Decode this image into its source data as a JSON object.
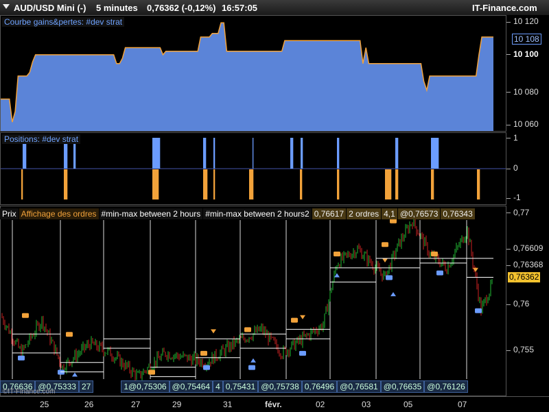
{
  "title": {
    "instrument": "AUD/USD Mini (-)",
    "timeframe": "5 minutes",
    "price": "0,76362 (-0,12%)",
    "time": "16:57:05",
    "brand": "IT-Finance.com"
  },
  "equity_panel": {
    "label": "Courbe gains&pertes: #dev strat",
    "ticks": [
      "10 120",
      "10 108",
      "10 100",
      "10 080",
      "10 060"
    ],
    "chart_data": {
      "type": "area",
      "y": [
        10075,
        10075,
        10075,
        10075,
        10062,
        10068,
        10088,
        10088,
        10088,
        10088,
        10090,
        10096,
        10100,
        10100,
        10100,
        10100,
        10100,
        10100,
        10100,
        10100,
        10100,
        10100,
        10100,
        10100,
        10100,
        10100,
        10100,
        10100,
        10100,
        10100,
        10100,
        10100,
        10100,
        10100,
        10100,
        10100,
        10100,
        10100,
        10100,
        10100,
        10095,
        10095,
        10098,
        10104,
        10104,
        10104,
        10104,
        10104,
        10104,
        10104,
        10104,
        10104,
        10104,
        10104,
        10104,
        10104,
        10100,
        10102,
        10102,
        10102,
        10102,
        10102,
        10102,
        10102,
        10102,
        10102,
        10102,
        10102,
        10102,
        10110,
        10110,
        10110,
        10110,
        10112,
        10112,
        10112,
        10118,
        10118,
        10102,
        10102,
        10102,
        10102,
        10102,
        10102,
        10102,
        10102,
        10102,
        10102,
        10102,
        10102,
        10102,
        10102,
        10102,
        10102,
        10102,
        10102,
        10102,
        10102,
        10108,
        10108,
        10108,
        10108,
        10108,
        10108,
        10108,
        10108,
        10108,
        10108,
        10108,
        10108,
        10108,
        10108,
        10108,
        10108,
        10108,
        10108,
        10108,
        10108,
        10108,
        10108,
        10108,
        10108,
        10108,
        10108,
        10108,
        10095,
        10104,
        10095,
        10095,
        10095,
        10095,
        10095,
        10095,
        10095,
        10095,
        10095,
        10095,
        10095,
        10095,
        10095,
        10095,
        10095,
        10095,
        10095,
        10095,
        10095,
        10085,
        10080,
        10088,
        10088,
        10088,
        10088,
        10088,
        10088,
        10088,
        10088,
        10088,
        10088,
        10088,
        10088,
        10088,
        10088,
        10088,
        10088,
        10088,
        10100,
        10110,
        10110,
        10110,
        10110,
        10110
      ],
      "ylim": [
        10057,
        10122
      ]
    }
  },
  "positions_panel": {
    "label": "Positions: #dev strat",
    "ticks": [
      "1",
      "0",
      "-1"
    ],
    "long_x": [
      32,
      33,
      34,
      35,
      36,
      92,
      93,
      94,
      95,
      96,
      106,
      107,
      108,
      221,
      222,
      223,
      224,
      225,
      226,
      227,
      228,
      229,
      230,
      231,
      295,
      296,
      297,
      298,
      310,
      311,
      367,
      422,
      423,
      424,
      425,
      437,
      438,
      439,
      490,
      491,
      492,
      575,
      576,
      577,
      578,
      627,
      628,
      629,
      630,
      631,
      632,
      633,
      634,
      635,
      636,
      637
    ],
    "short_x": [
      30,
      31,
      92,
      93,
      94,
      95,
      96,
      221,
      222,
      223,
      224,
      225,
      226,
      227,
      228,
      229,
      295,
      296,
      297,
      298,
      299,
      300,
      310,
      311,
      362,
      363,
      364,
      365,
      366,
      367,
      436,
      437,
      438,
      490,
      491,
      492,
      560,
      561,
      562,
      563,
      564,
      565,
      566,
      567,
      568,
      575,
      576,
      577,
      578,
      627,
      628,
      629,
      630,
      694,
      695,
      696,
      697
    ]
  },
  "price_panel": {
    "legend": [
      "Prix",
      "Affichage des ordres",
      "#min-max between 2 hours",
      "#min-max between 2 hours2",
      "0,76617",
      "2 ordres",
      "4,1",
      "@0,76573",
      "0,76343"
    ],
    "ticks": [
      "0,77",
      "0,76609",
      "0,76368",
      "0,76",
      "0,755"
    ],
    "current_price": "0,76362",
    "orders": [
      "0,76636",
      "@0,75333",
      "27",
      "1@0,75306",
      "@0,75464",
      "4",
      "0,75431",
      "@0,75738",
      "0,76496",
      "@0,76581",
      "@0,76635",
      "@0,76126"
    ],
    "chart_data": {
      "type": "line",
      "ylim": [
        0.7515,
        0.7715
      ],
      "colors": {
        "up": "#22bb33",
        "down": "#cc2222"
      }
    }
  },
  "time_axis": {
    "labels": [
      "25",
      "26",
      "27",
      "29",
      "31",
      "févr.",
      "02",
      "03",
      "05",
      "07"
    ]
  },
  "watermark": "©IT-Finance.com",
  "colors": {
    "equity_fill": "#5b84d8",
    "equity_edge": "#f2a23a",
    "long": "#6b9cff",
    "short": "#f2a23a",
    "current_price_bg": "#f2c12e"
  }
}
